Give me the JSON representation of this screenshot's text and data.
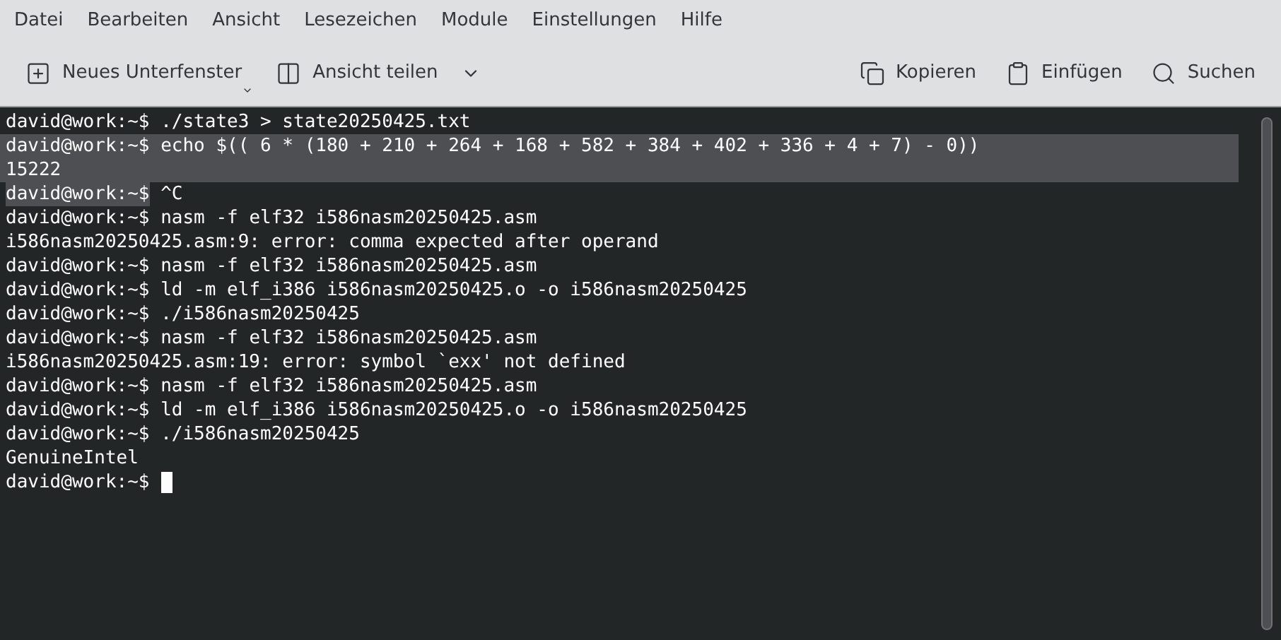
{
  "menu": [
    "Datei",
    "Bearbeiten",
    "Ansicht",
    "Lesezeichen",
    "Module",
    "Einstellungen",
    "Hilfe"
  ],
  "toolbar": {
    "left": [
      {
        "label": "Neues Unterfenster",
        "kind": "new-tab"
      },
      {
        "label": "Ansicht teilen",
        "kind": "split"
      }
    ],
    "right": [
      {
        "label": "Kopieren",
        "kind": "copy"
      },
      {
        "label": "Einfügen",
        "kind": "paste"
      },
      {
        "label": "Suchen",
        "kind": "search"
      }
    ]
  },
  "terminal": {
    "cursor": true,
    "lines": [
      {
        "kind": "command",
        "prompt": "david@work:~$",
        "text": "./state3 > state20250425.txt",
        "selected": false,
        "prompt_selected": false
      },
      {
        "kind": "command",
        "prompt": "david@work:~$",
        "text": "echo $(( 6 * (180 + 210 + 264 + 168 + 582 + 384 + 402 + 336 + 4 + 7) - 0))",
        "selected": true,
        "prompt_selected": true
      },
      {
        "kind": "output",
        "text": "15222",
        "selected": true
      },
      {
        "kind": "command",
        "prompt": "david@work:~$",
        "text": "^C",
        "selected": false,
        "prompt_selected": true
      },
      {
        "kind": "command",
        "prompt": "david@work:~$",
        "text": "nasm -f elf32 i586nasm20250425.asm",
        "selected": false,
        "prompt_selected": false
      },
      {
        "kind": "output",
        "text": "i586nasm20250425.asm:9: error: comma expected after operand",
        "selected": false
      },
      {
        "kind": "command",
        "prompt": "david@work:~$",
        "text": "nasm -f elf32 i586nasm20250425.asm",
        "selected": false,
        "prompt_selected": false
      },
      {
        "kind": "command",
        "prompt": "david@work:~$",
        "text": "ld -m elf_i386 i586nasm20250425.o -o i586nasm20250425",
        "selected": false,
        "prompt_selected": false
      },
      {
        "kind": "command",
        "prompt": "david@work:~$",
        "text": "./i586nasm20250425",
        "selected": false,
        "prompt_selected": false
      },
      {
        "kind": "command",
        "prompt": "david@work:~$",
        "text": "nasm -f elf32 i586nasm20250425.asm",
        "selected": false,
        "prompt_selected": false
      },
      {
        "kind": "output",
        "text": "i586nasm20250425.asm:19: error: symbol `exx' not defined",
        "selected": false
      },
      {
        "kind": "command",
        "prompt": "david@work:~$",
        "text": "nasm -f elf32 i586nasm20250425.asm",
        "selected": false,
        "prompt_selected": false
      },
      {
        "kind": "command",
        "prompt": "david@work:~$",
        "text": "ld -m elf_i386 i586nasm20250425.o -o i586nasm20250425",
        "selected": false,
        "prompt_selected": false
      },
      {
        "kind": "command",
        "prompt": "david@work:~$",
        "text": "./i586nasm20250425",
        "selected": false,
        "prompt_selected": false
      },
      {
        "kind": "output",
        "text": "GenuineIntel",
        "selected": false
      },
      {
        "kind": "command",
        "prompt": "david@work:~$",
        "selected": false,
        "prompt_selected": false
      }
    ]
  }
}
